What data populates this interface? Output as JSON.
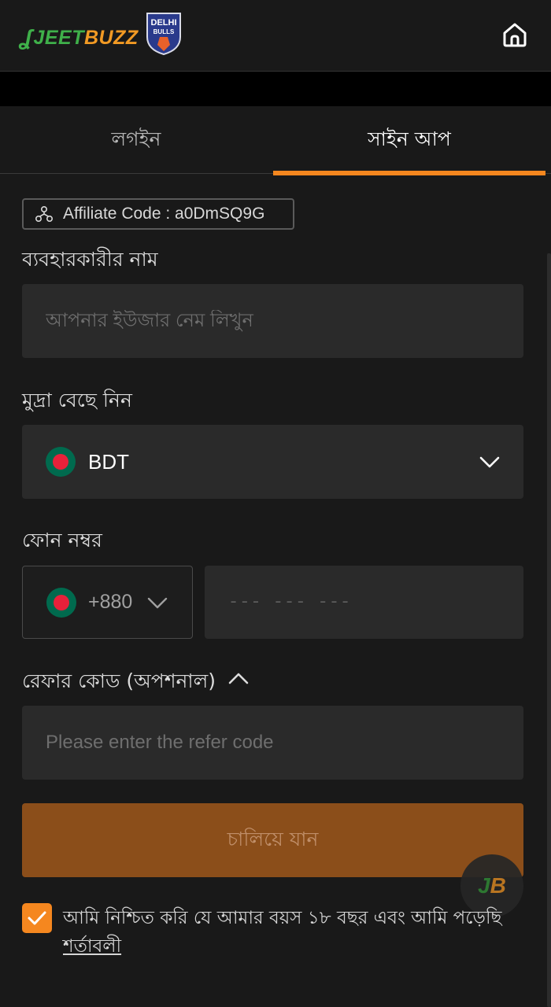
{
  "header": {
    "logo_text_a": "JEET",
    "logo_text_b": "BUZZ",
    "badge_line1": "DELHI",
    "badge_line2": "BULLS",
    "home_icon": "home-icon",
    "colors": {
      "brand_green": "#3fb04a",
      "brand_orange": "#f29a24"
    }
  },
  "tabs": [
    {
      "label": "লগইন",
      "active": false
    },
    {
      "label": "সাইন আপ",
      "active": true
    }
  ],
  "form": {
    "affiliate_label": "Affiliate Code : a0DmSQ9G",
    "username": {
      "label": "ব্যবহারকারীর নাম",
      "placeholder": "আপনার ইউজার নেম লিখুন",
      "value": ""
    },
    "currency": {
      "label": "মুদ্রা বেছে নিন",
      "selected": "BDT",
      "flag": "bangladesh-flag-icon"
    },
    "phone": {
      "label": "ফোন নম্বর",
      "country_code": "+880",
      "placeholder": "--- --- ---",
      "value": ""
    },
    "refer": {
      "label": "রেফার কোড (অপশনাল)",
      "placeholder": "Please enter the refer code",
      "value": "",
      "expanded": true
    },
    "submit_label": "চালিয়ে যান",
    "agree": {
      "checked": true,
      "text": "আমি নিশ্চিত করি যে আমার বয়স ১৮ বছর এবং আমি পড়েছি ",
      "link": "শর্তাবলী"
    }
  },
  "floating_button": {
    "text_a": "J",
    "text_b": "B"
  },
  "theme": {
    "accent": "#f5871f",
    "button_bg": "#8b4e1a",
    "bg": "#191919",
    "input_bg": "#2a2a2a"
  }
}
